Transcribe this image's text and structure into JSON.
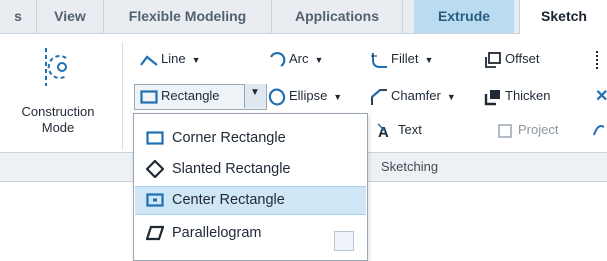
{
  "tabs": [
    "s",
    "View",
    "Flexible Modeling",
    "Applications",
    "Extrude",
    "Sketch"
  ],
  "construction": {
    "label_line1": "Construction",
    "label_line2": "Mode"
  },
  "commands": {
    "line": "Line",
    "arc": "Arc",
    "fillet": "Fillet",
    "offset": "Offset",
    "rectangle": "Rectangle",
    "ellipse": "Ellipse",
    "chamfer": "Chamfer",
    "thicken": "Thicken",
    "text": "Text",
    "project": "Project"
  },
  "group_label": "Sketching",
  "rectangle_menu": [
    {
      "label": "Corner Rectangle",
      "icon": "corner-rectangle-icon"
    },
    {
      "label": "Slanted Rectangle",
      "icon": "slanted-rectangle-icon"
    },
    {
      "label": "Center Rectangle",
      "icon": "center-rectangle-icon"
    },
    {
      "label": "Parallelogram",
      "icon": "parallelogram-icon"
    }
  ],
  "colors": {
    "accent": "#1f6fb2",
    "highlight": "#cfe6f7",
    "context_tab": "#b9dcf1"
  }
}
